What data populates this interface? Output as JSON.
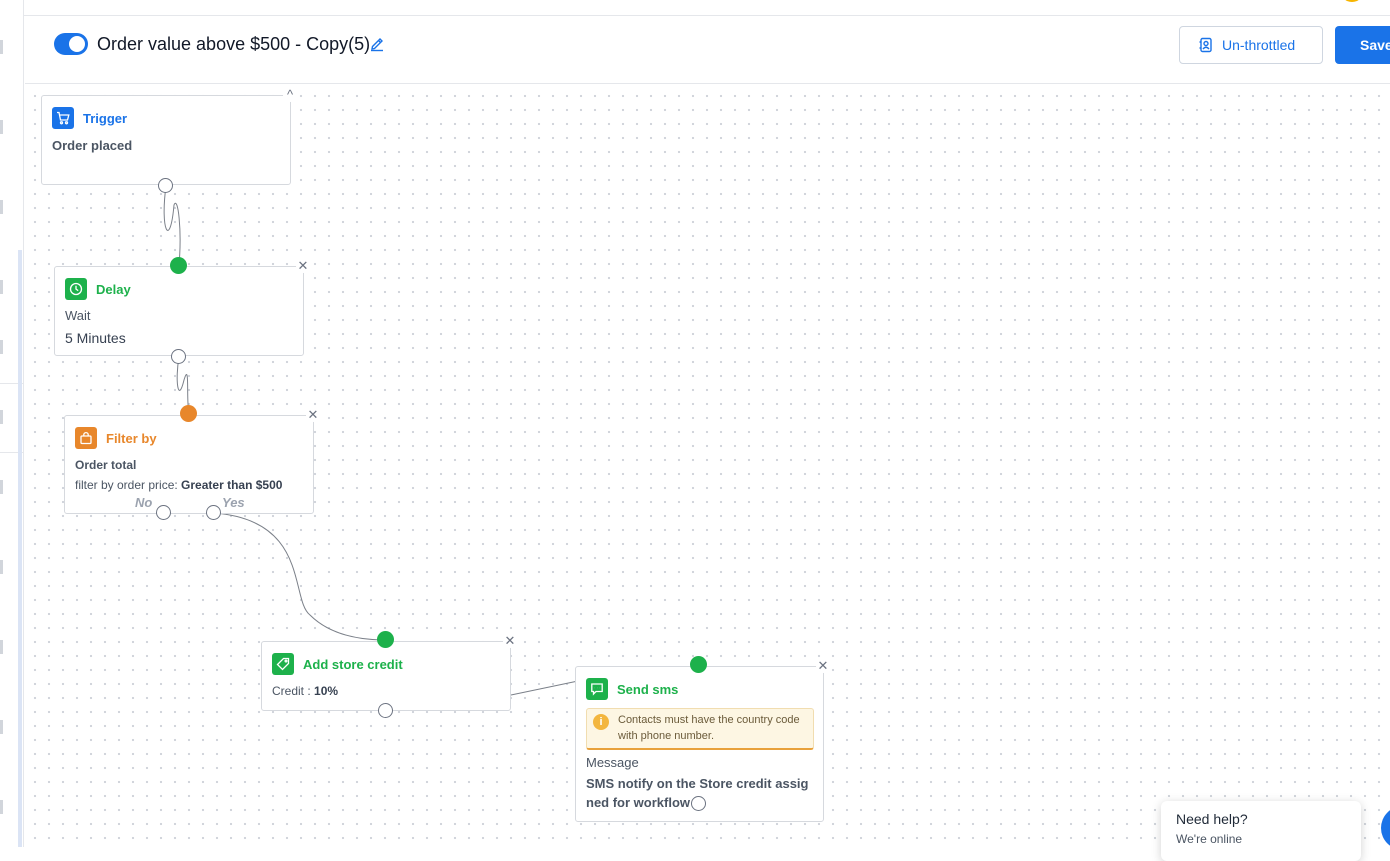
{
  "header": {
    "workflow_title": "Order value above $500 - Copy(5)",
    "throttle_label": "Un-throttled",
    "save_label": "Save"
  },
  "nodes": {
    "trigger": {
      "title": "Trigger",
      "line1": "Order placed"
    },
    "delay": {
      "title": "Delay",
      "label": "Wait",
      "value": "5 Minutes"
    },
    "filter": {
      "title": "Filter by",
      "field": "Order total",
      "condition_label": "filter by order price:",
      "condition_value": "Greater than $500",
      "no_label": "No",
      "yes_label": "Yes"
    },
    "store_credit": {
      "title": "Add store credit",
      "credit_label": "Credit :",
      "credit_value": "10%"
    },
    "send_sms": {
      "title": "Send sms",
      "warning": "Contacts must have the country code with phone number.",
      "message_label": "Message",
      "message_text": "SMS notify on the Store credit assigned for workflow"
    }
  },
  "help_widget": {
    "title": "Need help?",
    "subtitle": "We're online"
  },
  "colors": {
    "primary": "#1a73e8",
    "green": "#1db14b",
    "orange": "#e8872b",
    "warning_bg": "#fdf6e3"
  },
  "icons": {
    "trigger": "shopping-cart-icon",
    "delay": "clock-icon",
    "filter": "shopping-bag-icon",
    "store_credit": "tag-icon",
    "send_sms": "chat-message-icon",
    "throttle": "contact-card-icon",
    "edit": "pencil-icon",
    "warning": "info-icon"
  }
}
